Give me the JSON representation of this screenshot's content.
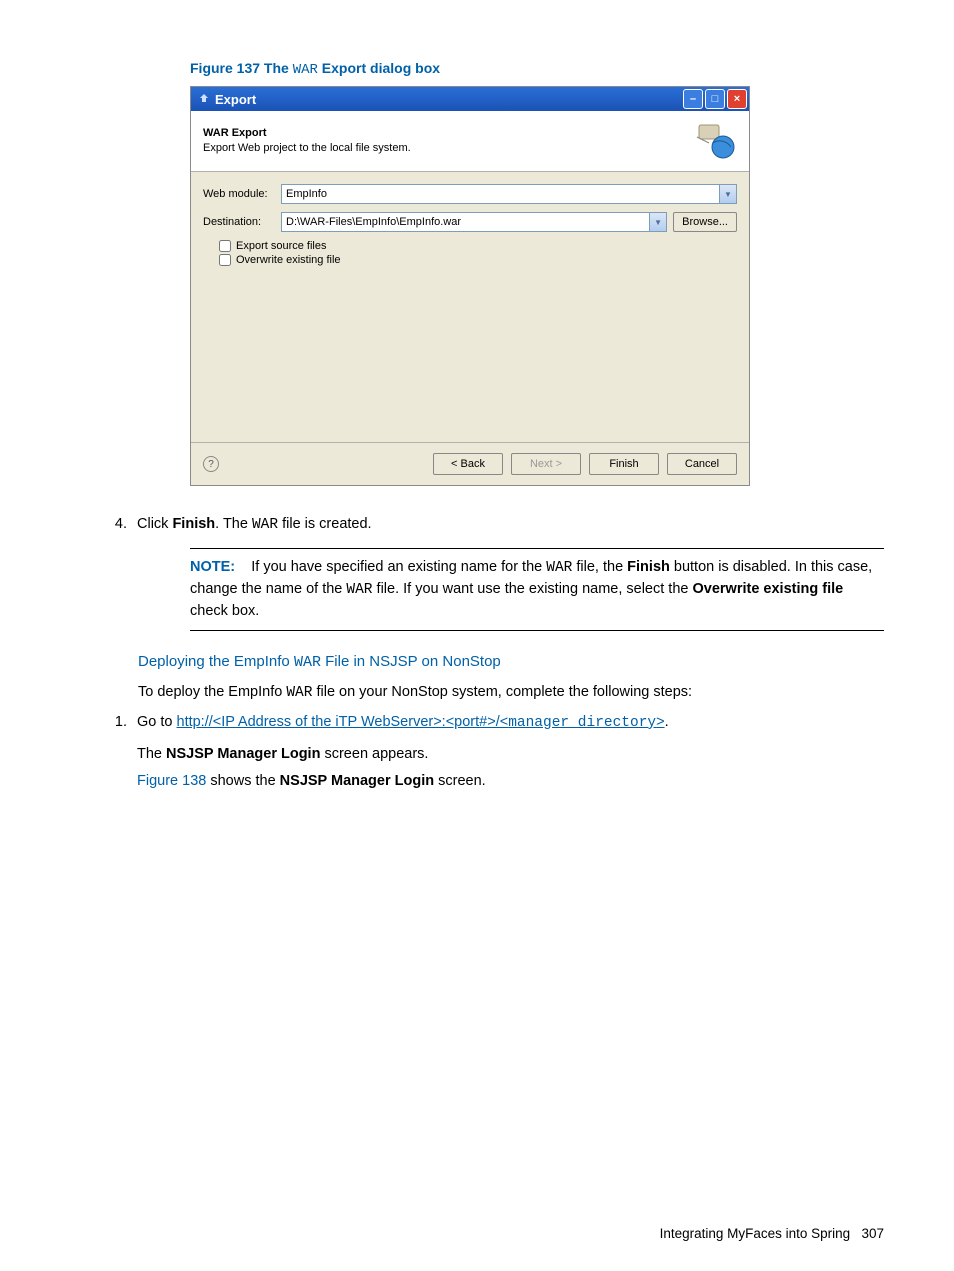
{
  "figure": {
    "label_prefix": "Figure 137 The ",
    "label_mono": "WAR",
    "label_suffix": " Export dialog box"
  },
  "dialog": {
    "title": "Export",
    "header_title": "WAR Export",
    "header_desc": "Export Web project to the local file system.",
    "web_module_label": "Web module:",
    "web_module_value": "EmpInfo",
    "destination_label": "Destination:",
    "destination_value": "D:\\WAR-Files\\EmpInfo\\EmpInfo.war",
    "browse_btn": "Browse...",
    "check_export_source": "Export source files",
    "check_overwrite": "Overwrite existing file",
    "btn_back": "< Back",
    "btn_next": "Next >",
    "btn_finish": "Finish",
    "btn_cancel": "Cancel"
  },
  "step4": {
    "num": "4.",
    "t1": "Click ",
    "t2": "Finish",
    "t3": ". The ",
    "t4": "WAR",
    "t5": " file is created."
  },
  "note": {
    "label": "NOTE:",
    "t1": "If you have specified an existing name for the ",
    "t2": "WAR",
    "t3": " file, the ",
    "t4": "Finish",
    "t5": " button is disabled. In this case, change the name of the ",
    "t6": "WAR",
    "t7": " file. If you want use the existing name, select the ",
    "t8": "Overwrite existing file",
    "t9": " check box."
  },
  "section": {
    "h_prefix": "Deploying the EmpInfo ",
    "h_mono": "WAR",
    "h_suffix": " File in NSJSP on NonStop",
    "p1_a": "To deploy the EmpInfo ",
    "p1_b": "WAR",
    "p1_c": " file on your NonStop system, complete the following steps:"
  },
  "step1": {
    "num": "1.",
    "t1": "Go to ",
    "link_plain": "http://<IP Address of the iTP WebServer>:<port#>/<",
    "link_mono": "manager directory",
    "link_end": ">",
    "t2": ".",
    "sub_a1": "The ",
    "sub_a2": "NSJSP Manager Login",
    "sub_a3": " screen appears.",
    "sub_b1": "Figure 138",
    "sub_b2": " shows the ",
    "sub_b3": "NSJSP Manager Login",
    "sub_b4": " screen."
  },
  "footer": {
    "text": "Integrating MyFaces into Spring",
    "page": "307"
  }
}
